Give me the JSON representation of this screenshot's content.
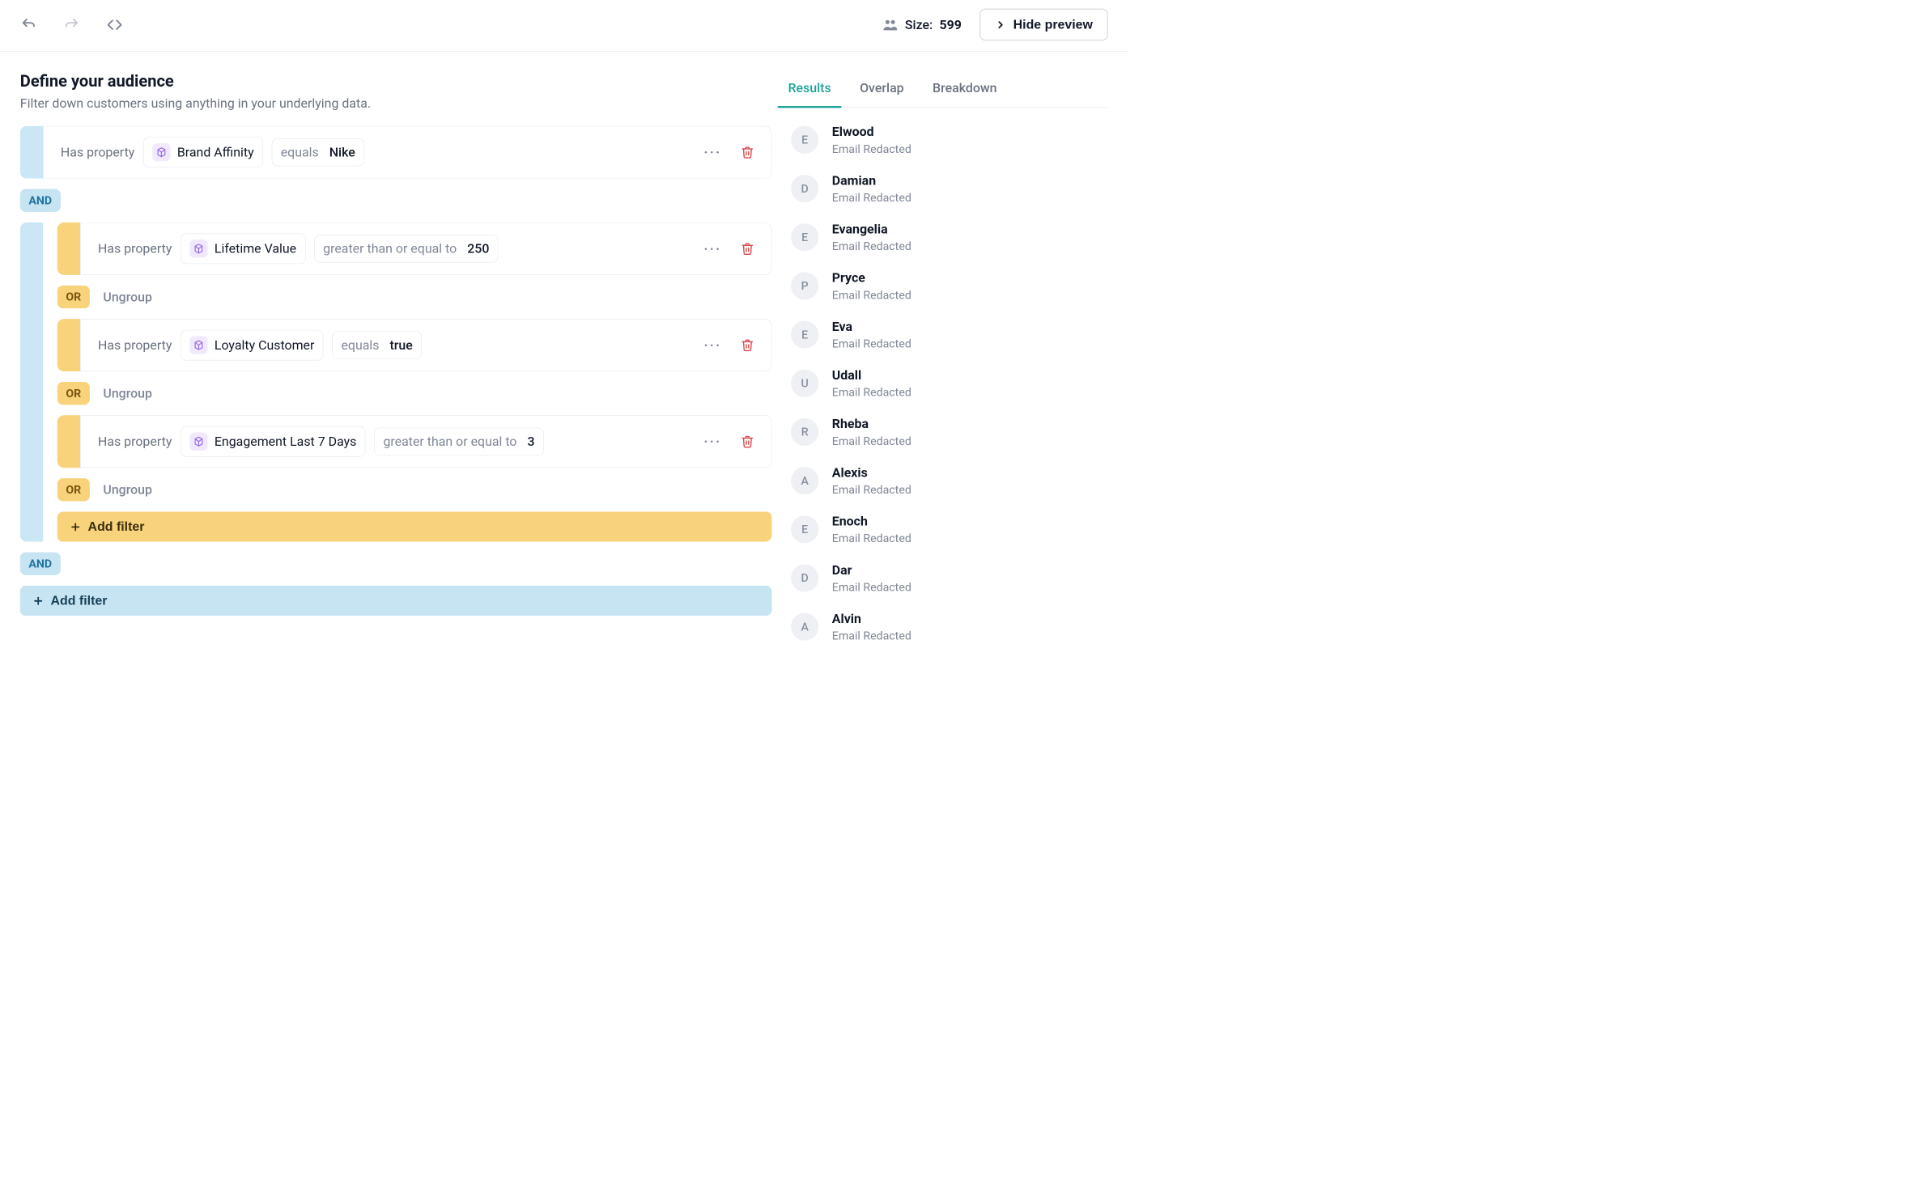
{
  "toolbar": {
    "size_prefix": "Size:",
    "size_value": "599",
    "hide_preview": "Hide preview"
  },
  "header": {
    "title": "Define your audience",
    "subtitle": "Filter down customers using anything in your underlying data."
  },
  "labels": {
    "has_property": "Has property",
    "ungroup": "Ungroup",
    "add_filter": "Add filter",
    "and": "AND",
    "or": "OR"
  },
  "filters": {
    "top": {
      "property": "Brand Affinity",
      "operator": "equals",
      "value": "Nike"
    },
    "group": [
      {
        "property": "Lifetime Value",
        "operator": "greater than or equal to",
        "value": "250"
      },
      {
        "property": "Loyalty Customer",
        "operator": "equals",
        "value": "true"
      },
      {
        "property": "Engagement Last 7 Days",
        "operator": "greater than or equal to",
        "value": "3"
      }
    ]
  },
  "tabs": [
    "Results",
    "Overlap",
    "Breakdown"
  ],
  "results": [
    {
      "initial": "E",
      "name": "Elwood",
      "sub": "Email Redacted"
    },
    {
      "initial": "D",
      "name": "Damian",
      "sub": "Email Redacted"
    },
    {
      "initial": "E",
      "name": "Evangelia",
      "sub": "Email Redacted"
    },
    {
      "initial": "P",
      "name": "Pryce",
      "sub": "Email Redacted"
    },
    {
      "initial": "E",
      "name": "Eva",
      "sub": "Email Redacted"
    },
    {
      "initial": "U",
      "name": "Udall",
      "sub": "Email Redacted"
    },
    {
      "initial": "R",
      "name": "Rheba",
      "sub": "Email Redacted"
    },
    {
      "initial": "A",
      "name": "Alexis",
      "sub": "Email Redacted"
    },
    {
      "initial": "E",
      "name": "Enoch",
      "sub": "Email Redacted"
    },
    {
      "initial": "D",
      "name": "Dar",
      "sub": "Email Redacted"
    },
    {
      "initial": "A",
      "name": "Alvin",
      "sub": "Email Redacted"
    }
  ]
}
